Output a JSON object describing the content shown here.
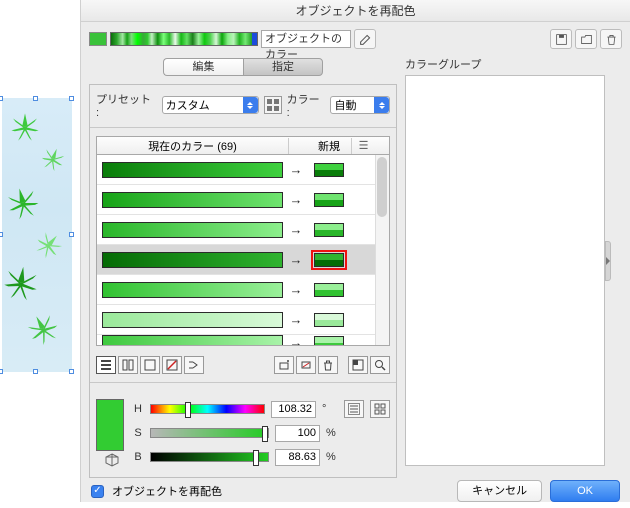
{
  "dialog": {
    "title": "オブジェクトを再配色",
    "object_color_label": "オブジェクトのカラー",
    "tabs": {
      "edit": "編集",
      "assign": "指定"
    },
    "preset_label": "プリセット :",
    "preset_value": "カスタム",
    "color_label": "カラー :",
    "color_mode_value": "自動",
    "table": {
      "current_header": "現在のカラー (69)",
      "new_header": "新規",
      "rows": [
        {
          "bar_from": "#0a7d0a",
          "bar_to": "#3fd13f",
          "chip": "#2ab52a",
          "selected": false
        },
        {
          "bar_from": "#17a317",
          "bar_to": "#6fe46f",
          "chip": "#44c544",
          "selected": false
        },
        {
          "bar_from": "#29b629",
          "bar_to": "#8cee8c",
          "chip": "#5fd55f",
          "selected": false
        },
        {
          "bar_from": "#056b05",
          "bar_to": "#2fb32f",
          "chip": "#1d991d",
          "selected": true
        },
        {
          "bar_from": "#31c231",
          "bar_to": "#9af09a",
          "chip": "#68db68",
          "selected": false
        },
        {
          "bar_from": "#9ae99a",
          "bar_to": "#d9f9d9",
          "chip": "#b9f0b9",
          "selected": false
        },
        {
          "bar_from": "#3ec93e",
          "bar_to": "#a9f3a9",
          "chip": "#76e076",
          "selected": false
        }
      ]
    },
    "hsb": {
      "h_label": "H",
      "s_label": "S",
      "b_label": "B",
      "h_value": "108.32",
      "s_value": "100",
      "b_value": "88.63",
      "deg": "°",
      "pct": "%"
    },
    "color_groups_label": "カラーグループ",
    "recolor_checkbox_label": "オブジェクトを再配色",
    "cancel": "キャンセル",
    "ok": "OK"
  },
  "icons": {
    "pencil": "pencil",
    "disk": "disk",
    "folder": "folder",
    "trash": "trash",
    "grid": "grid",
    "menu": "menu",
    "magnify": "magnify",
    "sliders": "sliders"
  }
}
